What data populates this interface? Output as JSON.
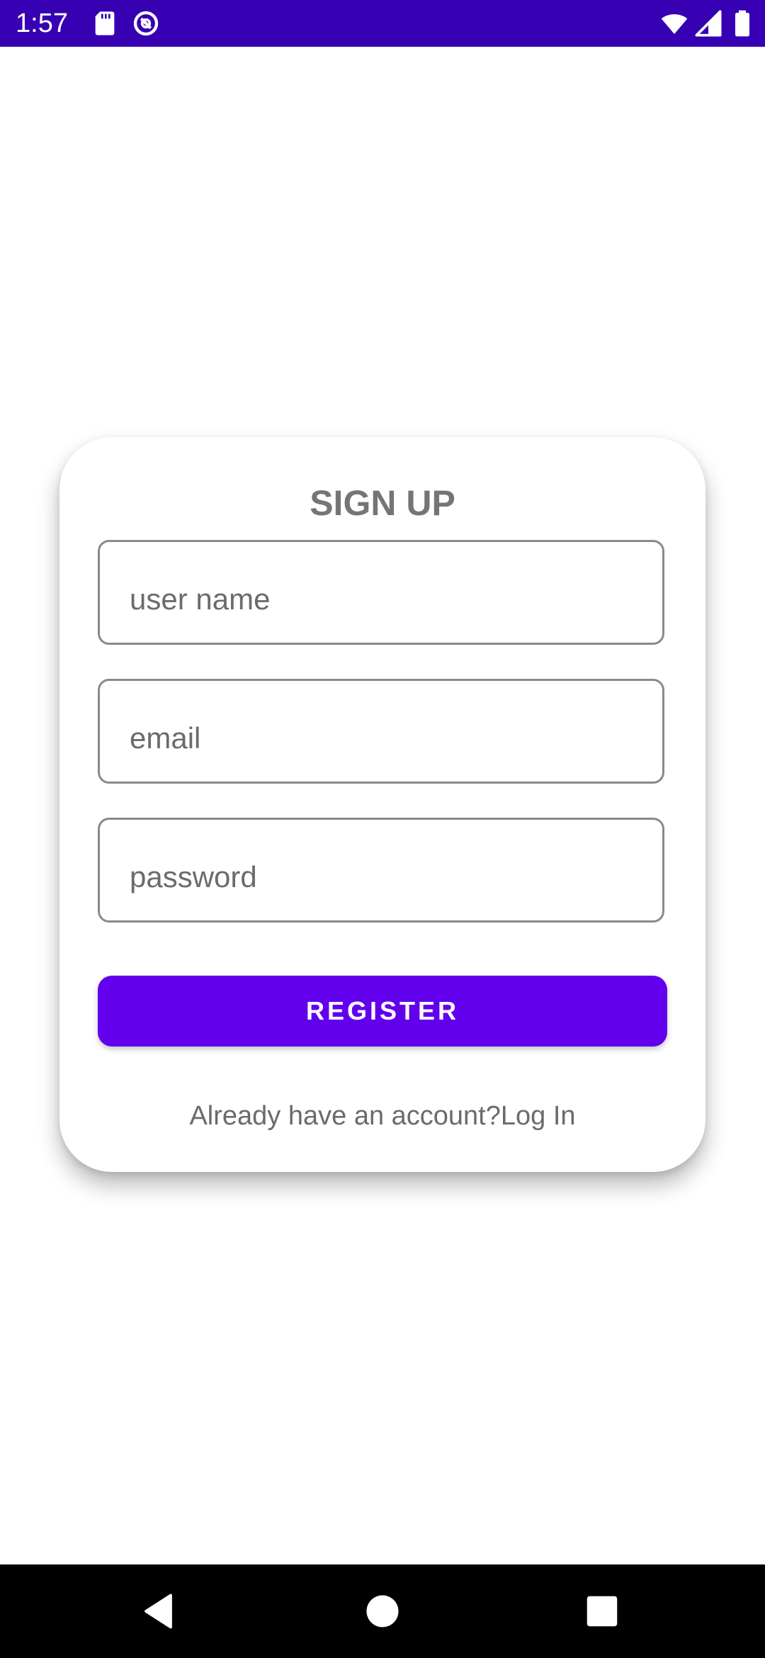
{
  "status_bar": {
    "time": "1:57",
    "background": "#3700b3"
  },
  "signup": {
    "title": "SIGN UP",
    "username_placeholder": "user name",
    "email_placeholder": "email",
    "password_placeholder": "password",
    "register_label": "REGISTER",
    "login_prompt": "Already have an account?",
    "login_link": "Log In",
    "accent_color": "#6200ee"
  },
  "nav_bar": {
    "icons": [
      "back-icon",
      "home-icon",
      "recents-icon"
    ]
  }
}
